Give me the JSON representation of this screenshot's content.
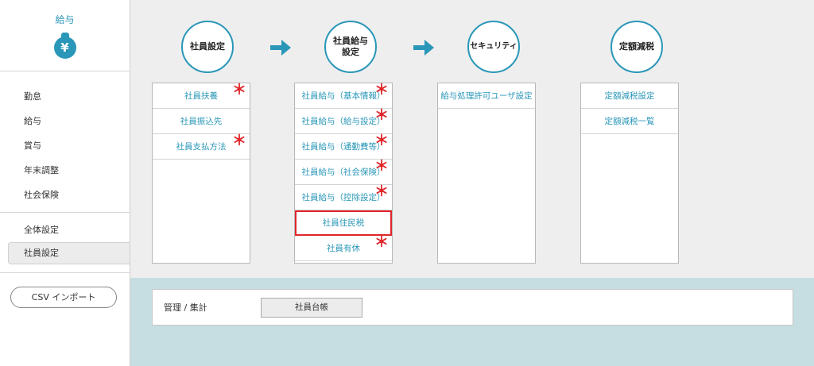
{
  "sidebar": {
    "title": "給与",
    "bag_icon_glyph": "¥",
    "items": [
      {
        "label": "勤怠"
      },
      {
        "label": "給与"
      },
      {
        "label": "賞与"
      },
      {
        "label": "年末調整"
      },
      {
        "label": "社会保険"
      }
    ],
    "items2": [
      {
        "label": "全体設定"
      },
      {
        "label": "社員設定"
      }
    ],
    "csv_button": "CSV インポート"
  },
  "steps": [
    {
      "label": "社員設定"
    },
    {
      "label": "社員給与\n設定"
    },
    {
      "label": "セキュリティ"
    },
    {
      "label": "定額減税"
    }
  ],
  "columns": [
    {
      "items": [
        {
          "label": "社員扶養",
          "required": "＊"
        },
        {
          "label": "社員振込先",
          "required": ""
        },
        {
          "label": "社員支払方法",
          "required": "＊"
        }
      ]
    },
    {
      "items": [
        {
          "label": "社員給与（基本情報）",
          "required": "＊"
        },
        {
          "label": "社員給与（給与設定）",
          "required": "＊"
        },
        {
          "label": "社員給与（通勤費等）",
          "required": "＊"
        },
        {
          "label": "社員給与（社会保険）",
          "required": "＊"
        },
        {
          "label": "社員給与（控除設定）",
          "required": "＊"
        },
        {
          "label": "社員住民税",
          "required": ""
        },
        {
          "label": "社員有休",
          "required": "＊"
        }
      ]
    },
    {
      "items": [
        {
          "label": "給与処理許可ユーザ設定",
          "required": ""
        }
      ]
    },
    {
      "items": [
        {
          "label": "定額減税設定",
          "required": ""
        },
        {
          "label": "定額減税一覧",
          "required": ""
        }
      ]
    }
  ],
  "panel": {
    "label": "管理 / 集計",
    "button": "社員台帳"
  },
  "colors": {
    "accent": "#2a97b8",
    "required": "#e0252a",
    "bottom_bg": "#c6dde2"
  }
}
